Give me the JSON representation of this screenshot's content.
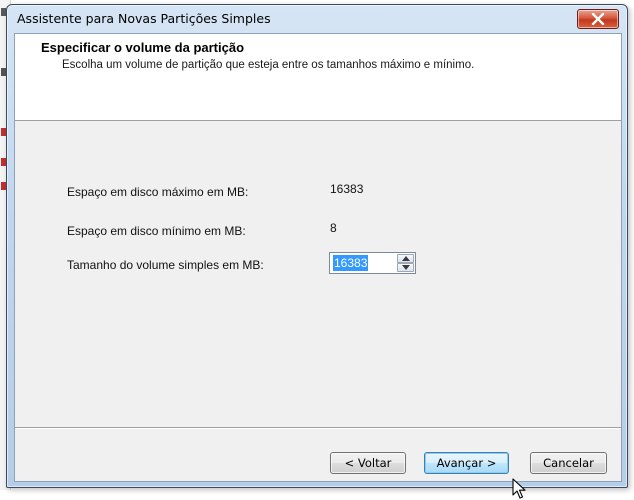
{
  "window": {
    "title": "Assistente para Novas Partições Simples",
    "close_icon": "close-icon"
  },
  "header": {
    "title": "Especificar o volume da partição",
    "subtitle": "Escolha um volume de partição que esteja entre os tamanhos máximo e mínimo."
  },
  "fields": {
    "max_label": "Espaço em disco máximo em MB:",
    "max_value": "16383",
    "min_label": "Espaço em disco mínimo em MB:",
    "min_value": "8",
    "size_label": "Tamanho do volume simples em MB:",
    "size_value": "16383"
  },
  "buttons": {
    "back": "< Voltar",
    "next": "Avançar >",
    "cancel": "Cancelar"
  },
  "icons": {
    "spin_up": "chevron-up-icon",
    "spin_down": "chevron-down-icon",
    "cursor": "mouse-pointer-icon"
  },
  "colors": {
    "selection": "#3399ff",
    "close_button": "#c0391d",
    "focused_button_border": "#3c7fb1"
  }
}
